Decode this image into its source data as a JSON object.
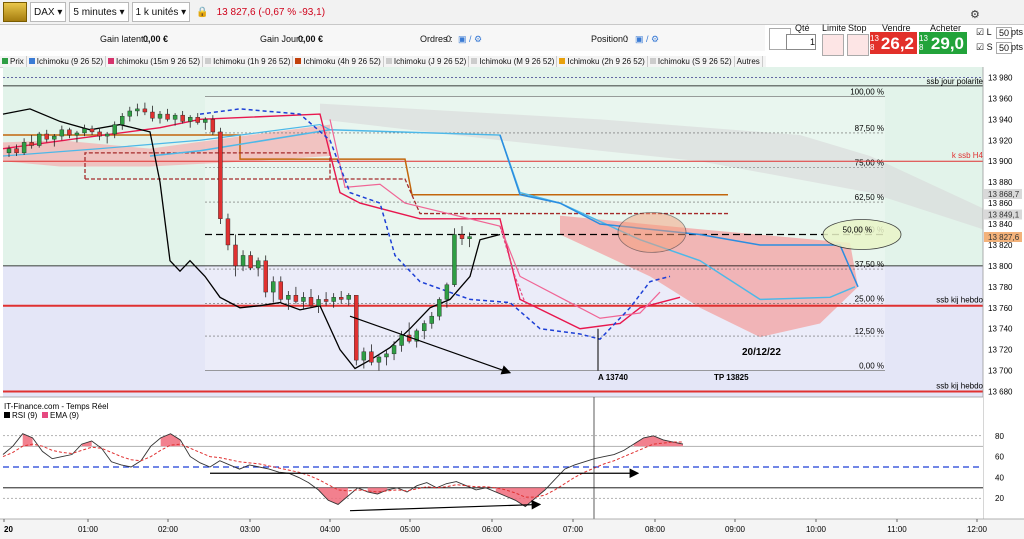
{
  "toolbar": {
    "instrument": "DAX",
    "timeframe": "5 minutes",
    "units": "1 k unités",
    "price_change": "13 827,6 (-0,67 % -93,1)"
  },
  "account": {
    "gain_latent_label": "Gain latent :",
    "gain_latent_value": "0,00 €",
    "gain_jour_label": "Gain Jour :",
    "gain_jour_value": "0,00 €",
    "ordres_label": "Ordres :",
    "ordres_value": "0",
    "position_label": "Position :",
    "position_value": "0"
  },
  "order_panel": {
    "qty_label": "Qté",
    "qty_value": "1",
    "limit_label": "Limite",
    "stop_label": "Stop",
    "sell_label": "Vendre",
    "sell_prefix": "13 8",
    "sell_price": "26,2",
    "buy_label": "Acheter",
    "buy_prefix": "13 8",
    "buy_price": "29,0",
    "l_label": "L",
    "s_label": "S",
    "l_value": "50",
    "s_value": "50",
    "pts": "pts"
  },
  "indicators": [
    {
      "label": "Prix",
      "color": "#2f9e44"
    },
    {
      "label": "Ichimoku (9 26 52)",
      "color": "#3a7bd5"
    },
    {
      "label": "Ichimoku (15m 9 26 52)",
      "color": "#d6336c"
    },
    {
      "label": "Ichimoku (1h 9 26 52)",
      "color": "#cccccc"
    },
    {
      "label": "Ichimoku (4h 9 26 52)",
      "color": "#c2410c"
    },
    {
      "label": "Ichimoku (J 9 26 52)",
      "color": "#cccccc"
    },
    {
      "label": "Ichimoku (M 9 26 52)",
      "color": "#cccccc"
    },
    {
      "label": "Ichimoku (2h 9 26 52)",
      "color": "#e8a10c"
    },
    {
      "label": "Ichimoku (S 9 26 52)",
      "color": "#cccccc"
    },
    {
      "label": "Autres",
      "color": ""
    }
  ],
  "chart_data": {
    "type": "candlestick",
    "ylim": [
      13670,
      13990
    ],
    "y_ticks": [
      "13 980",
      "13 960",
      "13 940",
      "13 920",
      "13 900",
      "13 880",
      "13 860",
      "13 840",
      "13 820",
      "13 800",
      "13 780",
      "13 760",
      "13 740",
      "13 720",
      "13 700",
      "13 680"
    ],
    "x_ticks": [
      "20",
      "01:00",
      "02:00",
      "03:00",
      "04:00",
      "05:00",
      "06:00",
      "07:00",
      "08:00",
      "09:00",
      "10:00",
      "11:00",
      "12:00"
    ],
    "price_tags": [
      {
        "value": "13 868,7",
        "y": 13868.7,
        "color": "#d9d9d9"
      },
      {
        "value": "13 849,1",
        "y": 13849.1,
        "color": "#d9d9d9"
      },
      {
        "value": "13 827,6",
        "y": 13827.6,
        "color": "#f3b27a"
      }
    ],
    "fib_levels": [
      {
        "label": "100,00 %",
        "y": 13962
      },
      {
        "label": "87,50 %",
        "y": 13927
      },
      {
        "label": "75,00 %",
        "y": 13894
      },
      {
        "label": "62,50 %",
        "y": 13861
      },
      {
        "label": "50,00 %",
        "y": 13830
      },
      {
        "label": "37,50 %",
        "y": 13797
      },
      {
        "label": "25,00 %",
        "y": 13764
      },
      {
        "label": "12,50 %",
        "y": 13733
      },
      {
        "label": "0,00 %",
        "y": 13700
      }
    ],
    "labels": {
      "ssb_jour": "ssb jour polarite",
      "k_ssb_h4": "k ssb  H4",
      "ssb_kij_1": "ssb kij hebdo",
      "ssb_kij_2": "ssb kij hebdo",
      "a_label": "A 13740",
      "tp_label": "TP  13825",
      "date_label": "20/12/22"
    },
    "candles": [
      [
        13908,
        13915,
        13904,
        13912
      ],
      [
        13912,
        13916,
        13905,
        13908
      ],
      [
        13908,
        13922,
        13906,
        13918
      ],
      [
        13918,
        13925,
        13912,
        13915
      ],
      [
        13915,
        13928,
        13913,
        13926
      ],
      [
        13926,
        13930,
        13918,
        13921
      ],
      [
        13921,
        13926,
        13914,
        13924
      ],
      [
        13924,
        13934,
        13920,
        13930
      ],
      [
        13930,
        13932,
        13922,
        13925
      ],
      [
        13925,
        13929,
        13918,
        13927
      ],
      [
        13927,
        13935,
        13924,
        13931
      ],
      [
        13931,
        13934,
        13925,
        13928
      ],
      [
        13928,
        13932,
        13920,
        13924
      ],
      [
        13924,
        13928,
        13917,
        13926
      ],
      [
        13926,
        13938,
        13922,
        13935
      ],
      [
        13935,
        13946,
        13930,
        13943
      ],
      [
        13943,
        13952,
        13938,
        13948
      ],
      [
        13948,
        13955,
        13943,
        13950
      ],
      [
        13950,
        13956,
        13944,
        13947
      ],
      [
        13947,
        13953,
        13938,
        13941
      ],
      [
        13941,
        13948,
        13936,
        13945
      ],
      [
        13945,
        13950,
        13938,
        13940
      ],
      [
        13940,
        13946,
        13934,
        13944
      ],
      [
        13944,
        13948,
        13936,
        13938
      ],
      [
        13938,
        13944,
        13932,
        13942
      ],
      [
        13942,
        13946,
        13935,
        13937
      ],
      [
        13937,
        13942,
        13930,
        13940
      ],
      [
        13940,
        13944,
        13925,
        13928
      ],
      [
        13928,
        13932,
        13840,
        13845
      ],
      [
        13845,
        13850,
        13815,
        13820
      ],
      [
        13820,
        13830,
        13790,
        13800
      ],
      [
        13800,
        13815,
        13795,
        13810
      ],
      [
        13810,
        13814,
        13796,
        13798
      ],
      [
        13798,
        13808,
        13790,
        13805
      ],
      [
        13805,
        13810,
        13770,
        13775
      ],
      [
        13775,
        13790,
        13765,
        13785
      ],
      [
        13785,
        13790,
        13765,
        13768
      ],
      [
        13768,
        13776,
        13758,
        13772
      ],
      [
        13772,
        13780,
        13764,
        13766
      ],
      [
        13766,
        13775,
        13758,
        13770
      ],
      [
        13770,
        13778,
        13760,
        13762
      ],
      [
        13762,
        13772,
        13755,
        13768
      ],
      [
        13768,
        13775,
        13762,
        13766
      ],
      [
        13766,
        13774,
        13760,
        13770
      ],
      [
        13770,
        13776,
        13764,
        13768
      ],
      [
        13768,
        13774,
        13762,
        13772
      ],
      [
        13772,
        13770,
        13705,
        13710
      ],
      [
        13710,
        13722,
        13702,
        13718
      ],
      [
        13718,
        13725,
        13705,
        13708
      ],
      [
        13708,
        13716,
        13700,
        13713
      ],
      [
        13713,
        13720,
        13705,
        13716
      ],
      [
        13716,
        13728,
        13710,
        13724
      ],
      [
        13724,
        13738,
        13718,
        13734
      ],
      [
        13734,
        13746,
        13726,
        13728
      ],
      [
        13728,
        13740,
        13722,
        13738
      ],
      [
        13738,
        13748,
        13730,
        13745
      ],
      [
        13745,
        13756,
        13740,
        13752
      ],
      [
        13752,
        13770,
        13748,
        13768
      ],
      [
        13768,
        13784,
        13760,
        13782
      ],
      [
        13782,
        13836,
        13780,
        13830
      ],
      [
        13830,
        13838,
        13820,
        13826
      ],
      [
        13826,
        13832,
        13818,
        13828
      ]
    ],
    "rsi_panel": {
      "title": "IT-Finance.com - Temps Réel",
      "legend": [
        "RSI (9)",
        "EMA (9)"
      ],
      "ylim": [
        0,
        100
      ],
      "y_ticks": [
        "80",
        "60",
        "40",
        "20"
      ],
      "rsi": [
        62,
        70,
        82,
        78,
        65,
        58,
        60,
        62,
        72,
        75,
        68,
        55,
        52,
        50,
        56,
        70,
        78,
        82,
        76,
        60,
        54,
        50,
        56,
        52,
        48,
        52,
        50,
        48,
        45,
        44,
        40,
        35,
        28,
        18,
        14,
        22,
        30,
        26,
        24,
        28,
        30,
        26,
        32,
        35,
        30,
        34,
        36,
        32,
        28,
        30,
        26,
        22,
        18,
        12,
        20,
        28,
        38,
        48,
        52,
        55,
        58,
        60,
        62,
        66,
        72,
        78,
        80,
        76,
        74,
        72
      ],
      "ema": [
        60,
        64,
        70,
        72,
        70,
        66,
        64,
        63,
        66,
        69,
        68,
        64,
        60,
        57,
        56,
        60,
        66,
        71,
        72,
        68,
        64,
        60,
        59,
        57,
        55,
        54,
        53,
        51,
        49,
        47,
        45,
        42,
        38,
        33,
        28,
        27,
        28,
        27,
        26,
        27,
        28,
        27,
        29,
        31,
        30,
        31,
        33,
        32,
        31,
        31,
        30,
        28,
        25,
        21,
        21,
        23,
        28,
        34,
        40,
        45,
        49,
        53,
        56,
        60,
        64,
        68,
        72,
        73,
        74,
        74
      ]
    }
  }
}
